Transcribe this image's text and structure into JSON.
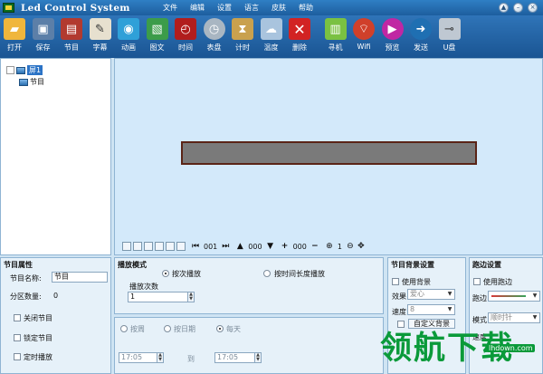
{
  "app": {
    "title": "Led Control System"
  },
  "menu": [
    "文件",
    "编辑",
    "设置",
    "语言",
    "皮肤",
    "帮助"
  ],
  "toolbar": {
    "items": [
      {
        "label": "打开",
        "icon": "open-folder-icon",
        "color": "#f0b63c"
      },
      {
        "label": "保存",
        "icon": "floppy-disk-icon",
        "color": "#5c7fa8"
      },
      {
        "label": "节目",
        "icon": "program-icon",
        "color": "#b23a2f"
      },
      {
        "label": "字幕",
        "icon": "subtitle-icon",
        "color": "#e7e0cf"
      },
      {
        "label": "动画",
        "icon": "animation-icon",
        "color": "#2fa0d8"
      },
      {
        "label": "图文",
        "icon": "image-text-icon",
        "color": "#3c9c4a"
      },
      {
        "label": "时间",
        "icon": "clock-icon",
        "color": "#b11d1d"
      },
      {
        "label": "表盘",
        "icon": "dial-icon",
        "color": "#a9b6c2"
      },
      {
        "label": "计时",
        "icon": "hourglass-icon",
        "color": "#c9a14e"
      },
      {
        "label": "温度",
        "icon": "temperature-icon",
        "color": "#a9c4de"
      },
      {
        "label": "删除",
        "icon": "delete-icon",
        "color": "#d22323"
      },
      {
        "label": "寻机",
        "icon": "find-device-icon",
        "color": "#7ac142"
      },
      {
        "label": "Wifi",
        "icon": "wifi-icon",
        "color": "#d0402a"
      },
      {
        "label": "预览",
        "icon": "preview-icon",
        "color": "#c027a3"
      },
      {
        "label": "发送",
        "icon": "send-icon",
        "color": "#1f6fb2"
      },
      {
        "label": "U盘",
        "icon": "usb-icon",
        "color": "#bfc8d2"
      }
    ]
  },
  "tree": {
    "screen": "屏1",
    "program": "节目"
  },
  "canvas_toolbar": {
    "page_value": "001",
    "layer_value": "000",
    "item_value": "000",
    "zoom_value": "1"
  },
  "program_props": {
    "title": "节目属性",
    "name_label": "节目名称:",
    "name_value": "节目",
    "zone_count_label": "分区数量:",
    "zone_count_value": "0",
    "close_label": "关闭节目",
    "lock_label": "锁定节目",
    "timed_label": "定时播放"
  },
  "play_mode": {
    "title": "播放模式",
    "by_count_label": "按次播放",
    "by_duration_label": "按时间长度播放",
    "count_label": "播放次数",
    "count_value": "1"
  },
  "date": {
    "weekly_label": "按周",
    "by_date_label": "按日期",
    "daily_label": "每天",
    "start_time": "17:05",
    "to_label": "到",
    "end_time": "17:05"
  },
  "bg_settings": {
    "title": "节目背景设置",
    "use_bg_label": "使用背景",
    "effect_label": "效果",
    "effect_value": "爱心",
    "speed_label": "速度",
    "speed_value": "8",
    "custom_bg_label": "自定义背景"
  },
  "border_settings": {
    "title": "跑边设置",
    "use_border_label": "使用跑边",
    "border_label": "跑边",
    "mode_label": "模式",
    "mode_value": "顺时针",
    "speed_label": "速度"
  },
  "watermark": {
    "text": "领航下载",
    "site": "lhdown.com"
  }
}
